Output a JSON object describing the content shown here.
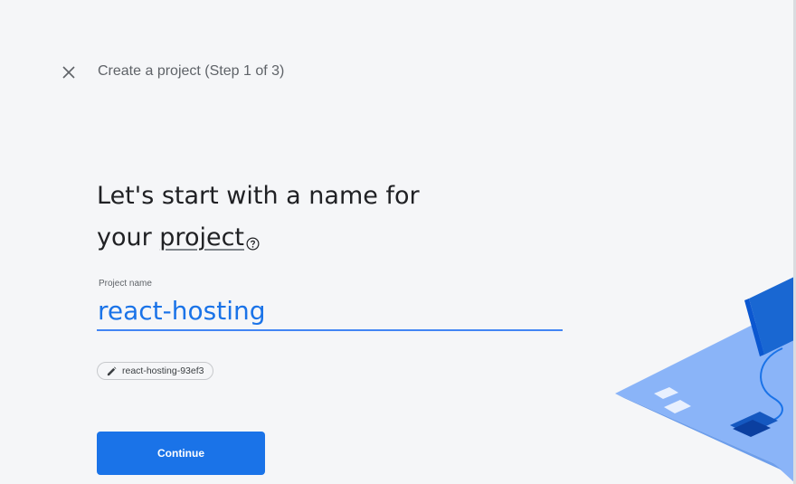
{
  "header": {
    "close_icon": "close-icon",
    "step_title": "Create a project (Step 1 of 3)"
  },
  "main": {
    "headline_line1": "Let's start with a name for",
    "headline_line2_prefix": "your ",
    "headline_line2_link": "project",
    "help_icon": "help-circle-icon"
  },
  "form": {
    "project_name_label": "Project name",
    "project_name_value": "react-hosting",
    "project_id_chip": "react-hosting-93ef3",
    "edit_icon": "pencil-icon",
    "continue_label": "Continue"
  },
  "colors": {
    "accent": "#1a73e8",
    "background": "#f5f6f8"
  }
}
